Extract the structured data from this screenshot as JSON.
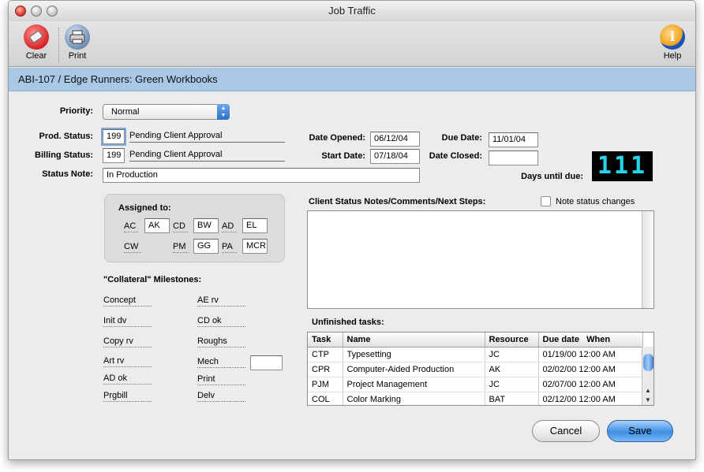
{
  "window": {
    "title": "Job Traffic"
  },
  "toolbar": {
    "clear_label": "Clear",
    "print_label": "Print",
    "help_label": "Help",
    "clear_icon": "eraser-icon",
    "print_icon": "printer-icon",
    "help_icon": "info-icon"
  },
  "header": {
    "job_title": "ABI-107 / Edge Runners:  Green Workbooks"
  },
  "form": {
    "priority_label": "Priority:",
    "priority_value": "Normal",
    "prod_status_label": "Prod. Status:",
    "prod_status_code": "199",
    "prod_status_text": "Pending Client Approval",
    "billing_status_label": "Billing Status:",
    "billing_status_code": "199",
    "billing_status_text": "Pending Client Approval",
    "status_note_label": "Status Note:",
    "status_note_value": "In Production",
    "date_opened_label": "Date Opened:",
    "date_opened_value": "06/12/04",
    "start_date_label": "Start Date:",
    "start_date_value": "07/18/04",
    "due_date_label": "Due Date:",
    "due_date_value": "11/01/04",
    "date_closed_label": "Date Closed:",
    "date_closed_value": "",
    "days_until_due_label": "Days until due:",
    "days_until_due_value": "111"
  },
  "assigned": {
    "title": "Assigned to:",
    "ac_label": "AC",
    "ac_value": "AK",
    "cd_label": "CD",
    "cd_value": "BW",
    "ad_label": "AD",
    "ad_value": "EL",
    "cw_label": "CW",
    "pm_label": "PM",
    "pm_value": "GG",
    "pa_label": "PA",
    "pa_value": "MCR"
  },
  "milestones": {
    "title": "\"Collateral\" Milestones:",
    "left": [
      "Concept",
      "Init dv",
      "Copy rv",
      "Art rv",
      "AD ok",
      "Prgbill"
    ],
    "right": [
      "AE rv",
      "CD ok",
      "Roughs",
      "Mech",
      "Print",
      "Delv"
    ]
  },
  "notes": {
    "label": "Client Status Notes/Comments/Next Steps:",
    "checkbox_label": "Note status changes",
    "value": ""
  },
  "tasks": {
    "label": "Unfinished tasks:",
    "headers": [
      "Task",
      "Name",
      "Resource",
      "Due date   When"
    ],
    "rows": [
      [
        "CTP",
        "Typesetting",
        "JC",
        "01/19/00 12:00 AM"
      ],
      [
        "CPR",
        "Computer-Aided Production",
        "AK",
        "02/02/00 12:00 AM"
      ],
      [
        "PJM",
        "Project Management",
        "JC",
        "02/07/00 12:00 AM"
      ],
      [
        "COL",
        "Color Marking",
        "BAT",
        "02/12/00 12:00 AM"
      ]
    ]
  },
  "buttons": {
    "cancel_label": "Cancel",
    "save_label": "Save"
  },
  "colors": {
    "banner": "#a9c8e6",
    "digital_display": "#27d4ec",
    "default_button": "#3f8fe6"
  }
}
